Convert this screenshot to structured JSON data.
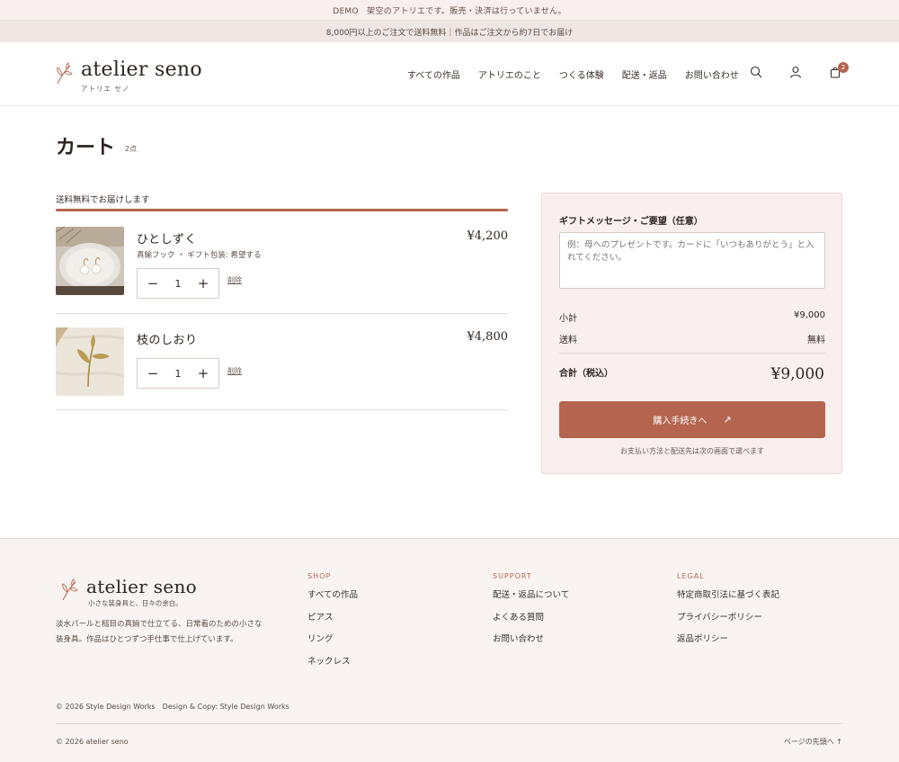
{
  "demo_bar": "DEMO　架空のアトリエです。販売・決済は行っていません。",
  "shipping_bar": "8,000円以上のご注文で送料無料｜作品はご注文から約7日でお届け",
  "header": {
    "brand": "atelier seno",
    "brand_kana": "アトリエ セノ",
    "nav": [
      "すべての作品",
      "アトリエのこと",
      "つくる体験",
      "配送・返品",
      "お問い合わせ"
    ],
    "cart_count": "2"
  },
  "page": {
    "title": "カート",
    "count": "2点"
  },
  "free_shipping": {
    "label": "送料無料でお届けします",
    "progress": 1.0
  },
  "items": [
    {
      "name": "ひとしずく",
      "options": "真鍮フック ・ ギフト包装: 希望する",
      "price": "¥4,200",
      "qty": "1",
      "remove": "削除"
    },
    {
      "name": "枝のしおり",
      "options": "",
      "price": "¥4,800",
      "qty": "1",
      "remove": "削除"
    }
  ],
  "qty_controls": {
    "minus": "−",
    "plus": "+"
  },
  "summary": {
    "gift_label": "ギフトメッセージ・ご要望（任意）",
    "gift_placeholder": "例：母へのプレゼントです。カードに「いつもありがとう」と入れてください。",
    "subtotal_label": "小計",
    "subtotal": "¥9,000",
    "shipping_label": "送料",
    "shipping": "無料",
    "total_label": "合計（税込）",
    "total": "¥9,000",
    "checkout": "購入手続きへ",
    "checkout_arrow": "↗",
    "note": "お支払い方法と配送先は次の画面で選べます"
  },
  "footer": {
    "brand": "atelier seno",
    "tagline": "小さな装身具と、日々の余白。",
    "description": "淡水パールと槌目の真鍮で仕立てる、日常着のための小さな装身具。作品はひとつずつ手仕事で仕上げています。",
    "columns": [
      {
        "heading": "SHOP",
        "links": [
          "すべての作品",
          "ピアス",
          "リング",
          "ネックレス"
        ]
      },
      {
        "heading": "SUPPORT",
        "links": [
          "配送・返品について",
          "よくある質問",
          "お問い合わせ"
        ]
      },
      {
        "heading": "LEGAL",
        "links": [
          "特定商取引法に基づく表記",
          "プライバシーポリシー",
          "返品ポリシー"
        ]
      }
    ],
    "credit": "© 2026 Style Design Works　Design & Copy: Style Design Works",
    "copyright": "© 2026 atelier seno",
    "back_to_top": "ページの先頭へ ↑"
  },
  "colors": {
    "accent": "#b5654f",
    "summary_bg": "#f8efee",
    "footer_bg": "#f9f4f2"
  },
  "icons": [
    "leaf-logo-icon",
    "search-icon",
    "user-icon",
    "bag-icon"
  ]
}
